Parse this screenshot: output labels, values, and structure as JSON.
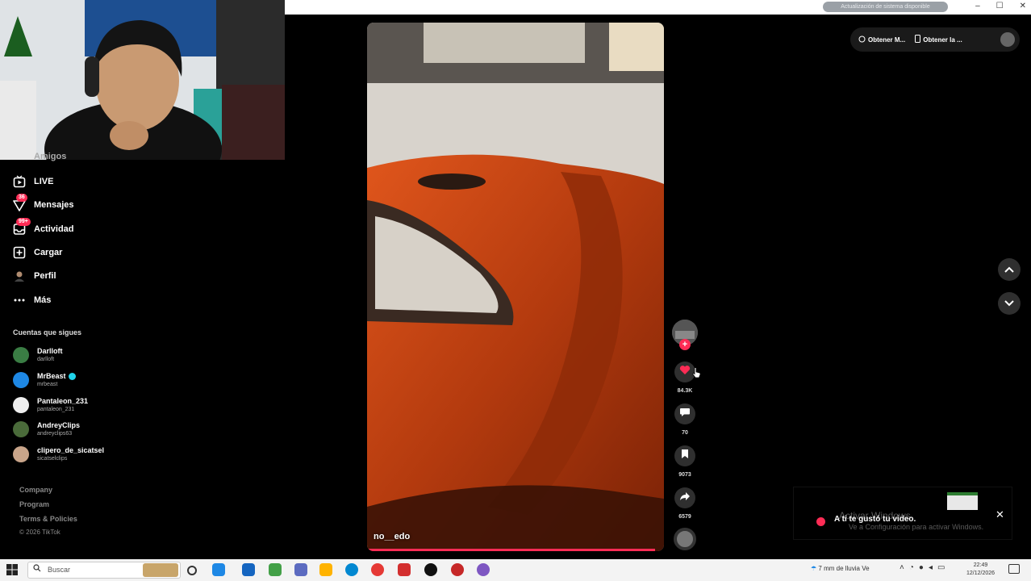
{
  "browser": {
    "url": "Actualización de sistema disponible"
  },
  "sidebar": {
    "partial_top": "Amigos",
    "items": [
      {
        "label": "LIVE"
      },
      {
        "label": "Mensajes",
        "badge": "36"
      },
      {
        "label": "Actividad",
        "badge": "99+"
      },
      {
        "label": "Cargar"
      },
      {
        "label": "Perfil"
      },
      {
        "label": "Más"
      }
    ],
    "following_title": "Cuentas que sigues",
    "following": [
      {
        "name": "Darlloft",
        "handle": "darlloft",
        "color": "#3a7d44"
      },
      {
        "name": "MrBeast",
        "handle": "mrbeast",
        "color": "#1e88e5",
        "verified": true
      },
      {
        "name": "Pantaleon_231",
        "handle": "pantaleon_231",
        "color": "#eeeeee"
      },
      {
        "name": "AndreyClips",
        "handle": "andreyclips63",
        "color": "#4a6b3a"
      },
      {
        "name": "clipero_de_sicatsel",
        "handle": "sicatselclips",
        "color": "#c9a58a"
      }
    ],
    "footer": [
      "Company",
      "Program",
      "Terms & Policies"
    ],
    "copyright": "© 2026 TikTok"
  },
  "video": {
    "author": "no__edo",
    "progress": 0.97
  },
  "actions": {
    "likes": "84.3K",
    "comments": "70",
    "saves": "9073",
    "shares": "6579"
  },
  "top_right": {
    "pill1": "Obtener M...",
    "pill2": "Obtener la ..."
  },
  "toast": {
    "message": "A ti te gustó tu video.",
    "watermark": "Activar Windows",
    "watermark_sub": "Ve a Configuración para activar Windows."
  },
  "taskbar": {
    "search_placeholder": "Buscar",
    "weather": "7 mm de lluvia Ve",
    "time": "22:49",
    "date": "12/12/2026"
  },
  "colors": {
    "accent": "#fe2c55",
    "background": "#000000"
  }
}
